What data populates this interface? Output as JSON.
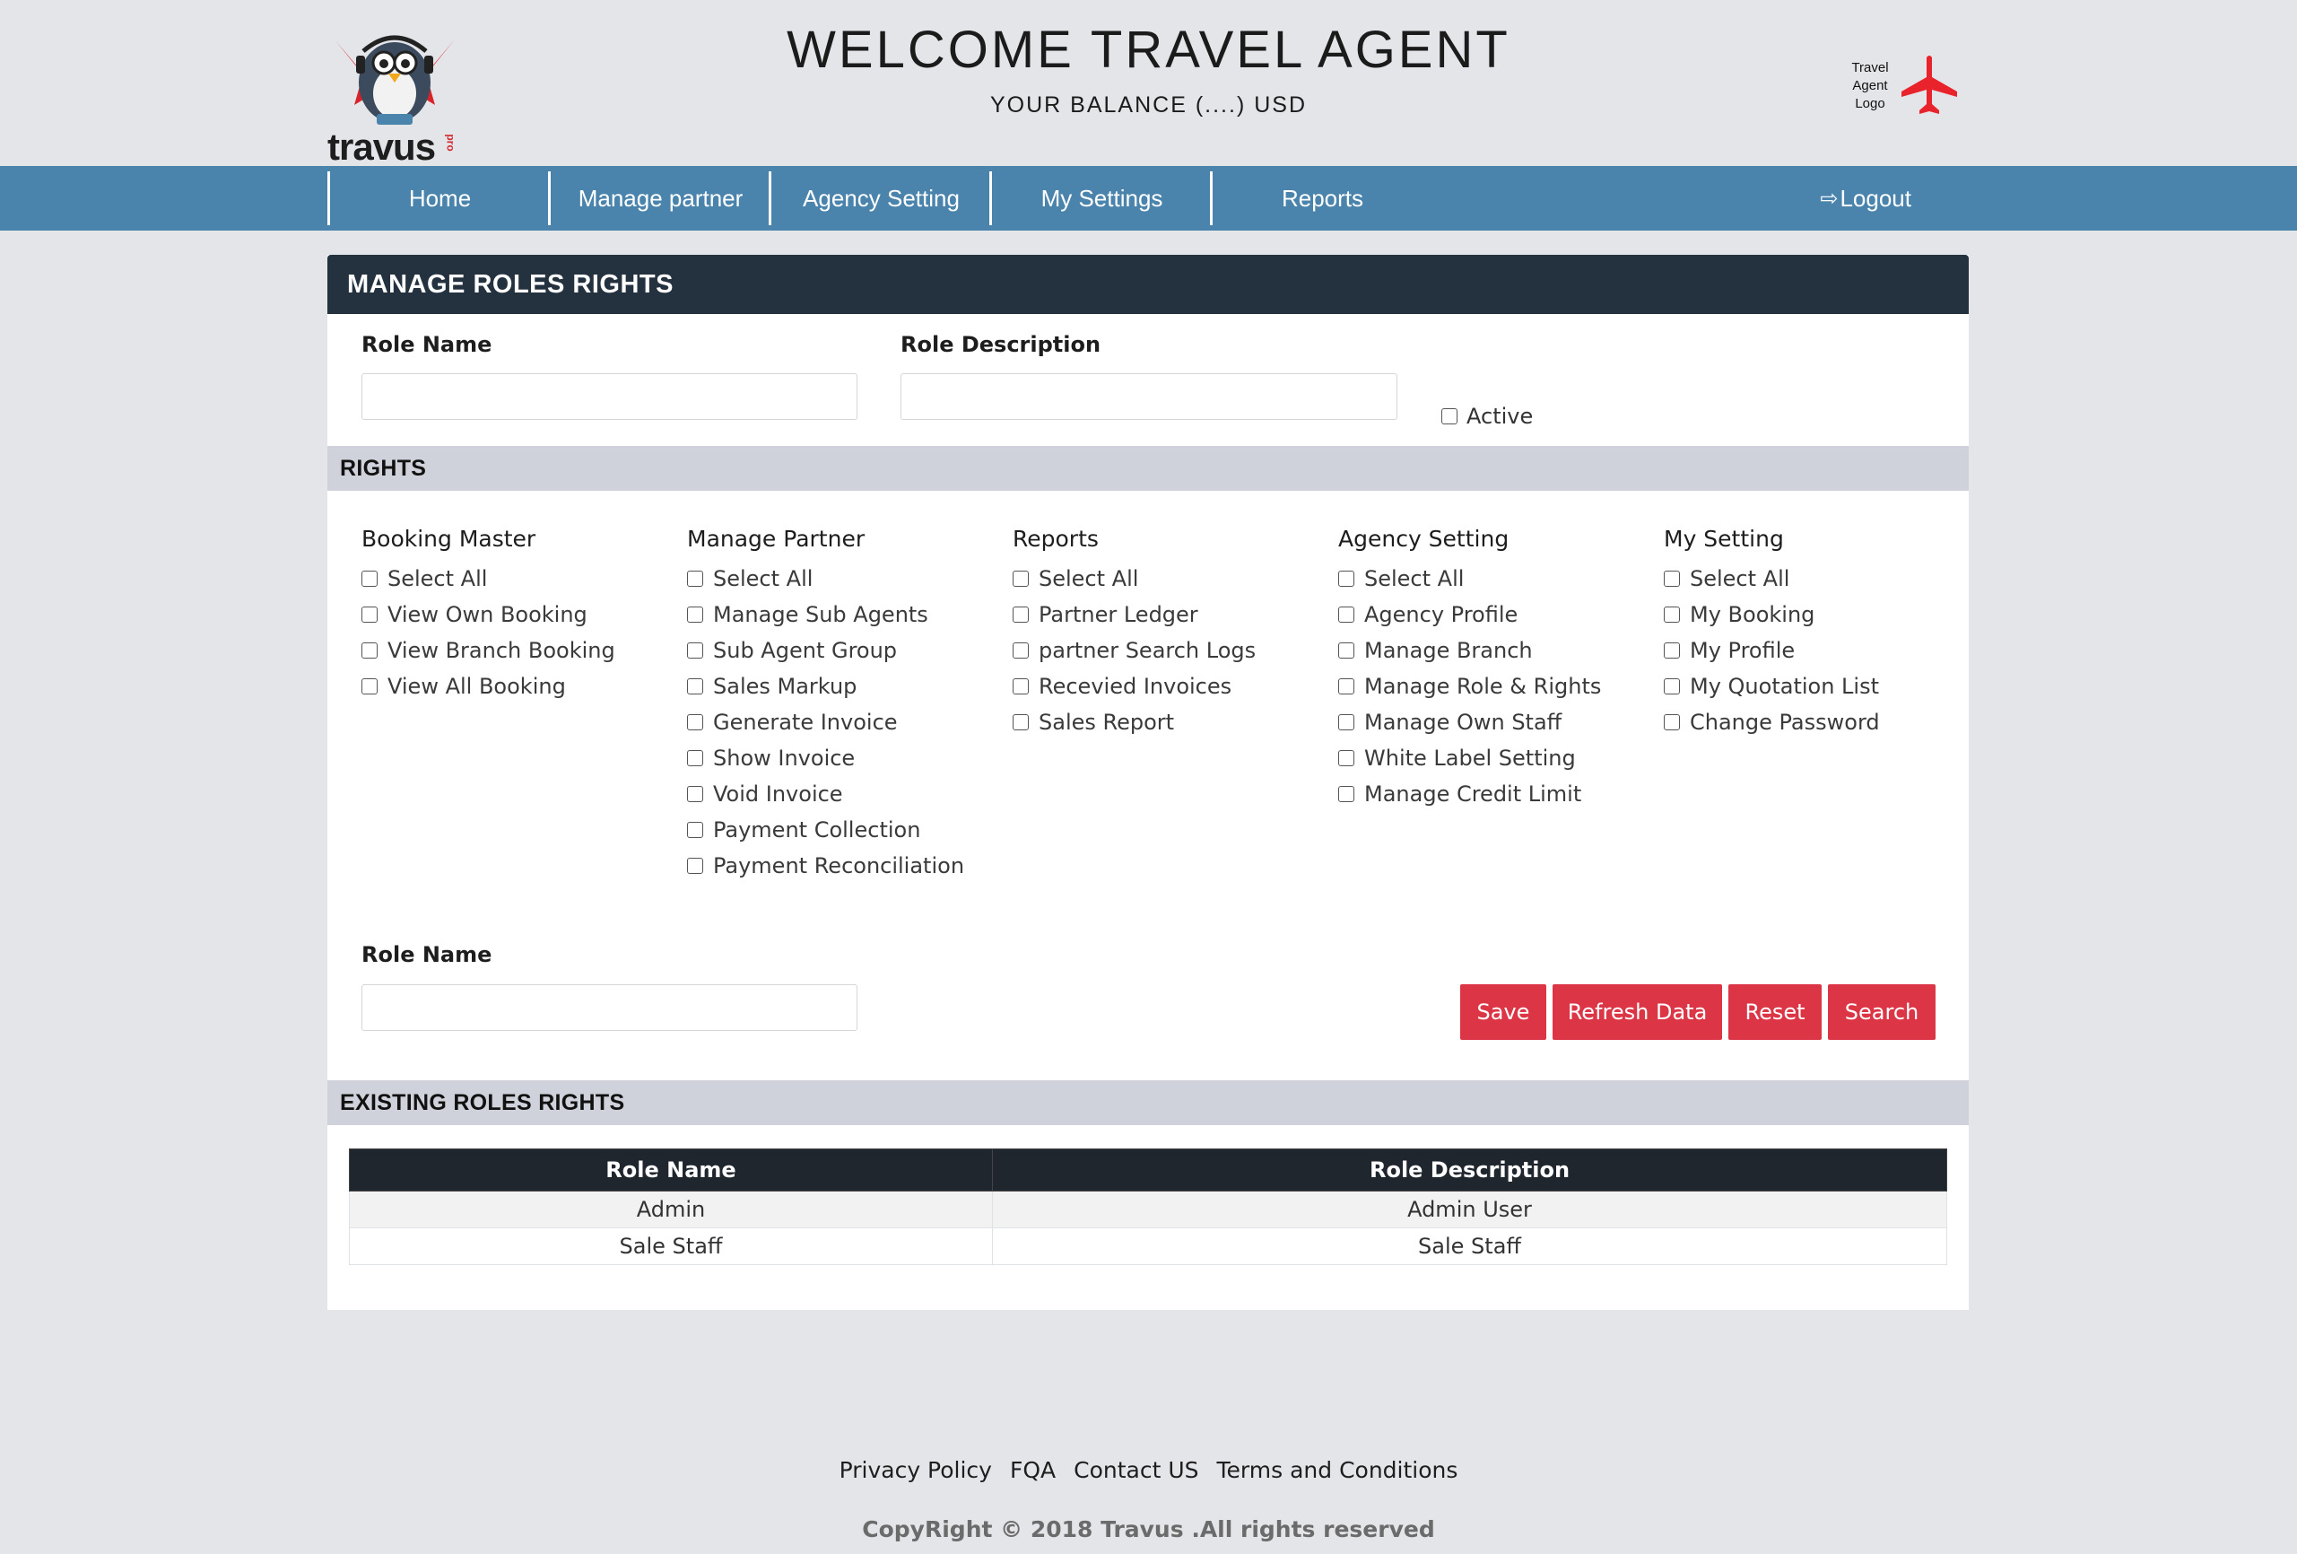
{
  "header": {
    "logo_text": "travus",
    "logo_sub": "pro",
    "welcome": "WELCOME TRAVEL AGENT",
    "balance": "YOUR BALANCE (....) USD",
    "agent_logo_text": "Travel Agent Logo"
  },
  "nav": {
    "items": [
      {
        "label": "Home"
      },
      {
        "label": "Manage partner"
      },
      {
        "label": "Agency Setting"
      },
      {
        "label": "My Settings"
      },
      {
        "label": "Reports"
      }
    ],
    "logout": "Logout"
  },
  "form": {
    "title": "MANAGE ROLES RIGHTS",
    "role_name_label": "Role Name",
    "role_name_value": "",
    "role_description_label": "Role Description",
    "role_description_value": "",
    "active_label": "Active"
  },
  "rights": {
    "title": "RIGHTS",
    "columns": [
      {
        "title": "Booking Master",
        "items": [
          "Select All",
          "View Own Booking",
          "View Branch Booking",
          "View All Booking"
        ]
      },
      {
        "title": "Manage Partner",
        "items": [
          "Select All",
          "Manage Sub Agents",
          "Sub Agent Group",
          "Sales Markup",
          "Generate Invoice",
          "Show Invoice",
          "Void Invoice",
          "Payment Collection",
          "Payment Reconciliation"
        ]
      },
      {
        "title": "Reports",
        "items": [
          "Select All",
          "Partner Ledger",
          "partner Search Logs",
          "Recevied Invoices",
          "Sales Report"
        ]
      },
      {
        "title": "Agency Setting",
        "items": [
          "Select All",
          "Agency Profile",
          "Manage Branch",
          "Manage Role & Rights",
          "Manage Own Staff",
          "White Label Setting",
          "Manage Credit Limit"
        ]
      },
      {
        "title": "My Setting",
        "items": [
          "Select All",
          "My Booking",
          "My Profile",
          "My Quotation List",
          "Change Password"
        ]
      }
    ]
  },
  "search": {
    "role_name_label": "Role Name",
    "role_name_value": ""
  },
  "buttons": {
    "save": "Save",
    "refresh": "Refresh Data",
    "reset": "Reset",
    "search": "Search"
  },
  "existing": {
    "title": "EXISTING ROLES RIGHTS",
    "headers": [
      "Role Name",
      "Role Description"
    ],
    "rows": [
      [
        "Admin",
        "Admin User"
      ],
      [
        "Sale Staff",
        "Sale Staff"
      ]
    ]
  },
  "footer": {
    "links": [
      "Privacy Policy",
      "FQA",
      "Contact US",
      "Terms and Conditions"
    ],
    "copyright": "CopyRight © 2018 Travus .All rights reserved"
  },
  "colors": {
    "navbar": "#4a84ad",
    "panel_header": "#243240",
    "button": "#dc3545",
    "section_bar": "#cfd2da",
    "accent_red": "#e8232b"
  }
}
